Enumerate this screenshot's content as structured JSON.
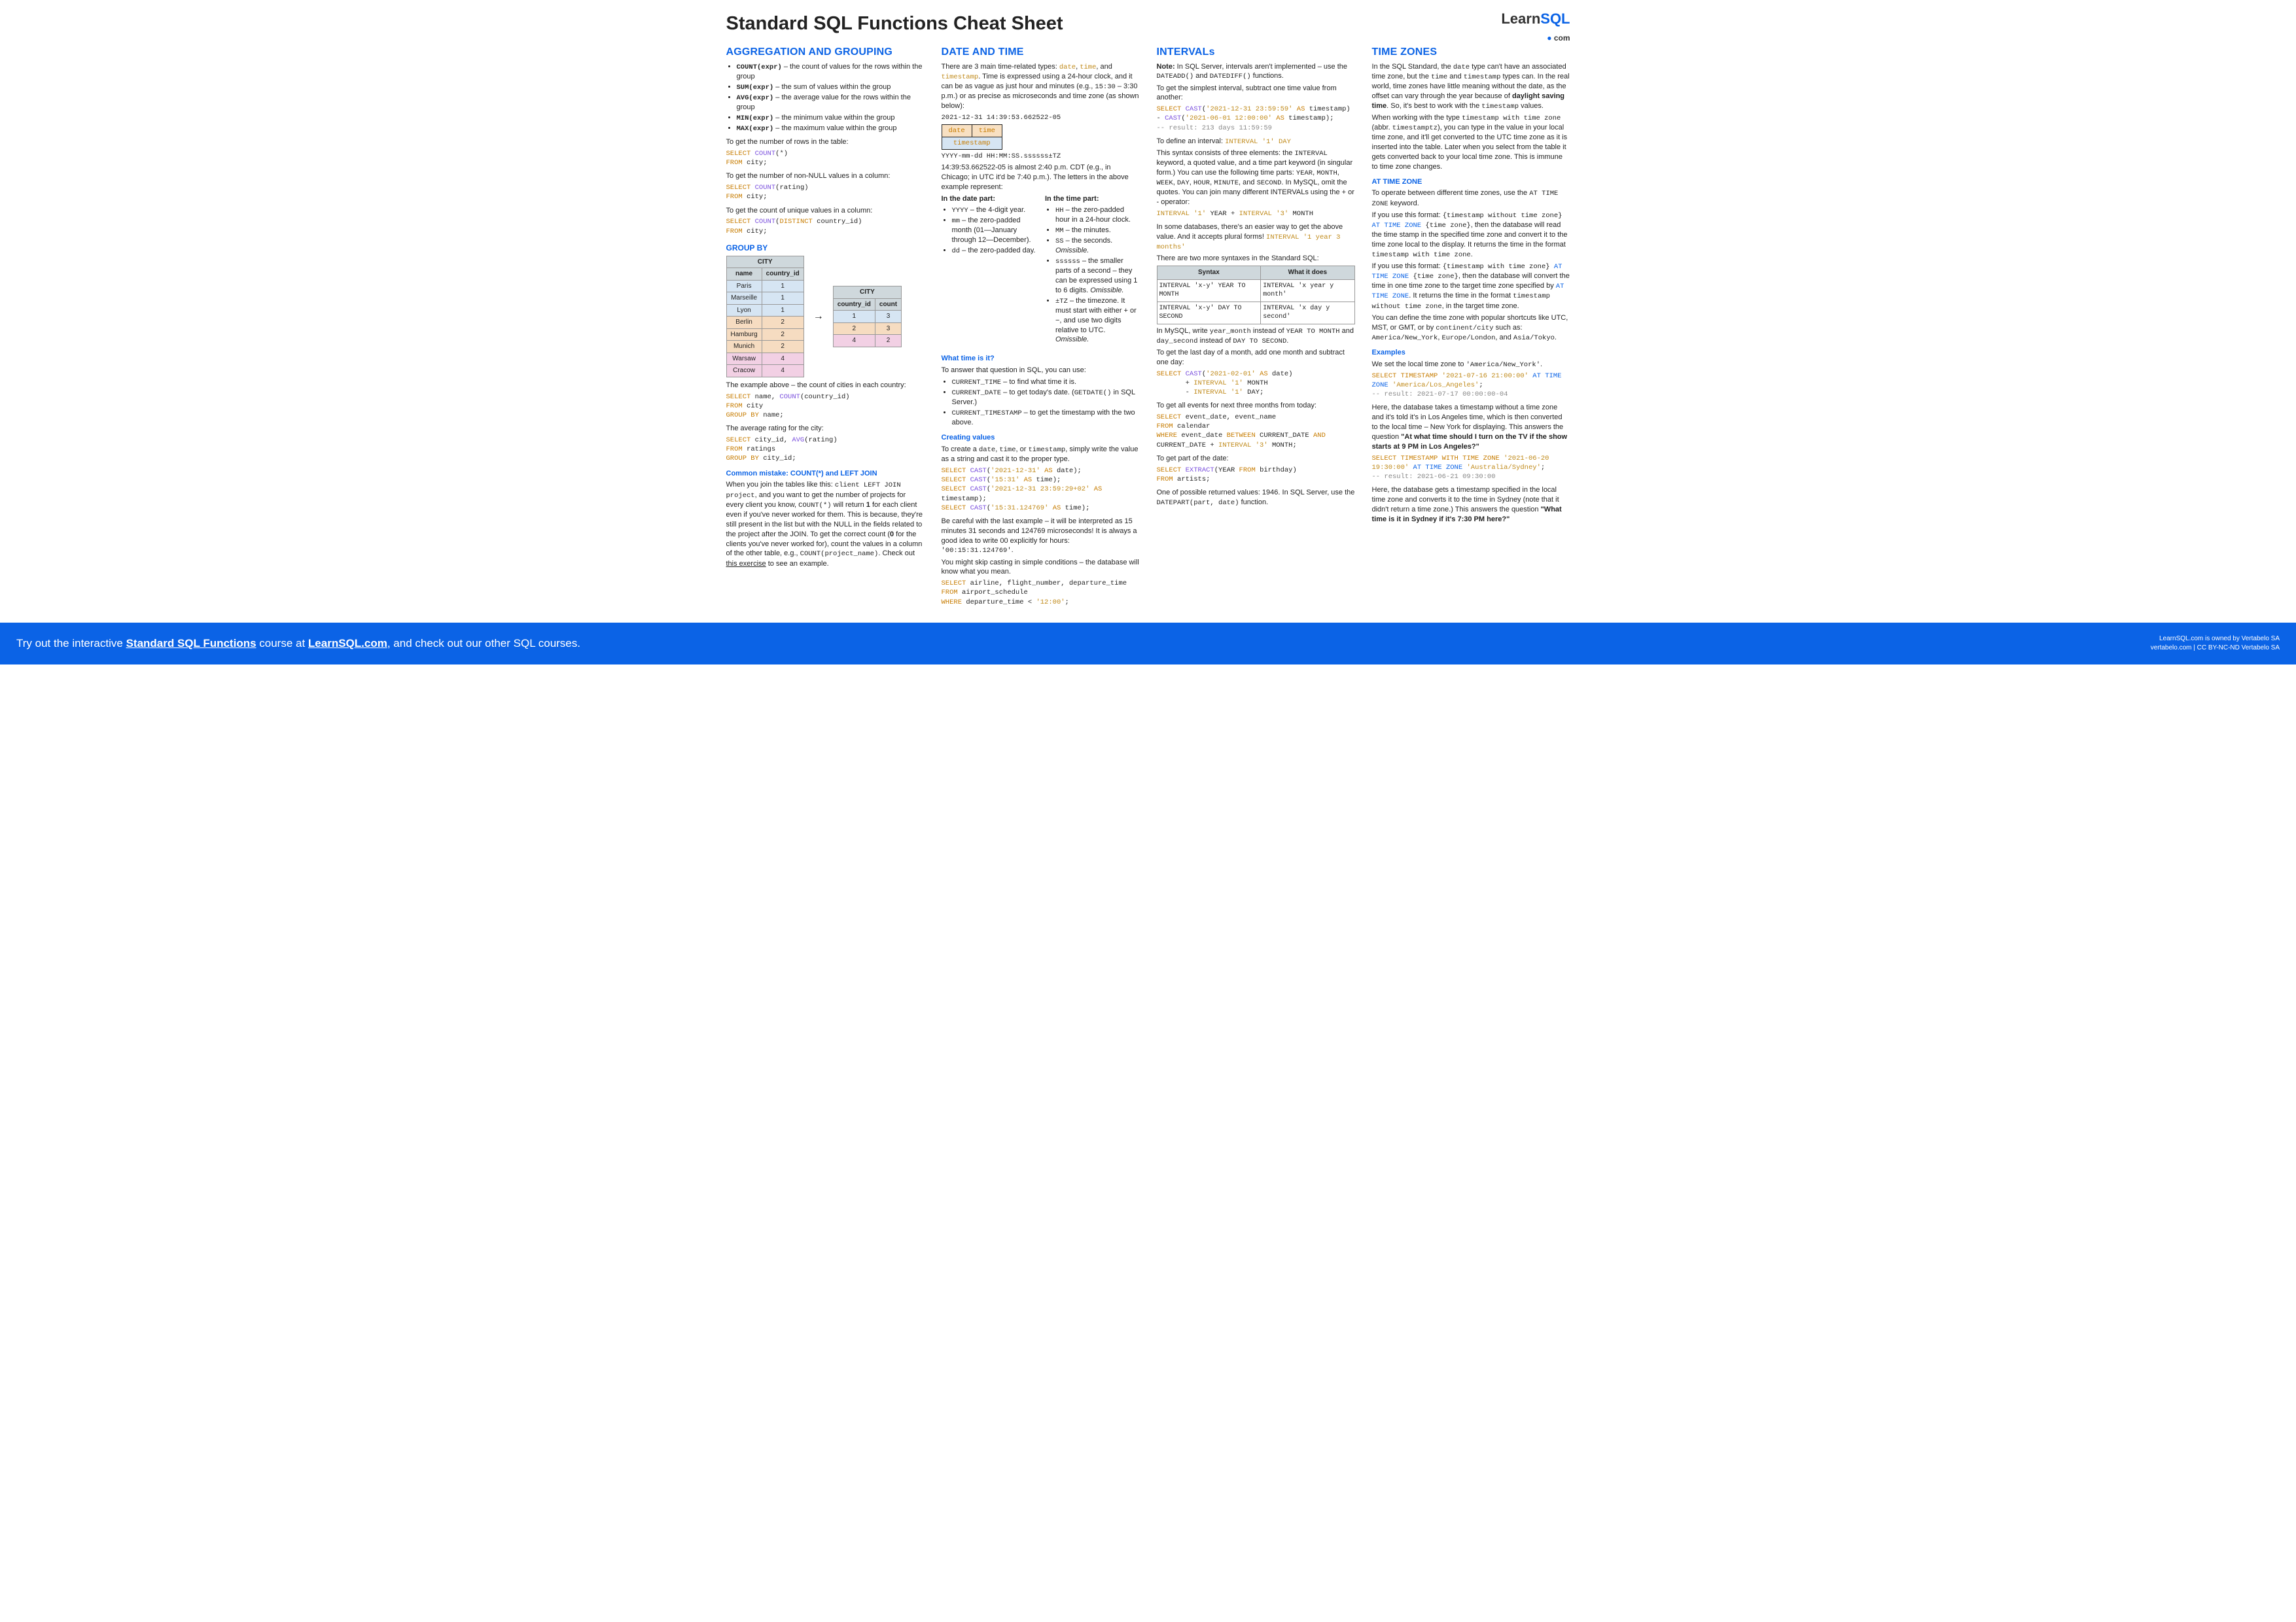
{
  "title": "Standard SQL Functions Cheat Sheet",
  "logo": {
    "brand": "Learn",
    "brand2": "SQL",
    "dot": "●",
    "com": "com"
  },
  "col1": {
    "h_agg": "AGGREGATION AND GROUPING",
    "fn_count": "COUNT(expr)",
    "fn_count_d": " – the count of values for the rows within the group",
    "fn_sum": "SUM(expr)",
    "fn_sum_d": " – the sum of values within the group",
    "fn_avg": "AVG(expr)",
    "fn_avg_d": " – the average value for the rows within the group",
    "fn_min": "MIN(expr)",
    "fn_min_d": " – the minimum value within the group",
    "fn_max": "MAX(expr)",
    "fn_max_d": " – the maximum value within the group",
    "p1": "To get the number of rows in the table:",
    "sql1": "SELECT COUNT(*)\nFROM city;",
    "p2": "To get the number of non-NULL values in a column:",
    "sql2": "SELECT COUNT(rating)\nFROM city;",
    "p3": "To get the count of unique values in a column:",
    "sql3": "SELECT COUNT(DISTINCT country_id)\nFROM city;",
    "h_group": "GROUP BY",
    "tbl1": {
      "caption": "CITY",
      "cols": [
        "name",
        "country_id"
      ],
      "rows": [
        [
          "Paris",
          "1",
          "b"
        ],
        [
          "Marseille",
          "1",
          "b"
        ],
        [
          "Lyon",
          "1",
          "b"
        ],
        [
          "Berlin",
          "2",
          "o"
        ],
        [
          "Hamburg",
          "2",
          "o"
        ],
        [
          "Munich",
          "2",
          "o"
        ],
        [
          "Warsaw",
          "4",
          "p"
        ],
        [
          "Cracow",
          "4",
          "p"
        ]
      ]
    },
    "tbl2": {
      "caption": "CITY",
      "cols": [
        "country_id",
        "count"
      ],
      "rows": [
        [
          "1",
          "3",
          "b"
        ],
        [
          "2",
          "3",
          "o"
        ],
        [
          "4",
          "2",
          "p"
        ]
      ]
    },
    "p4": "The example above – the count of cities in each country:",
    "sql4": "SELECT name, COUNT(country_id)\nFROM city\nGROUP BY name;",
    "p5": "The average rating for the city:",
    "sql5": "SELECT city_id, AVG(rating)\nFROM ratings\nGROUP BY city_id;",
    "h_mist": "Common mistake: COUNT(*) and LEFT JOIN",
    "p_mist": "When you join the tables like this: client LEFT JOIN project, and you want to get the number of projects for every client you know, COUNT(*) will return 1 for each client even if you've never worked for them. This is because, they're still present in the list but with the NULL in the fields related to the project after the JOIN. To get the correct count (0 for the clients you've never worked for), count the values in a column of the other table, e.g., COUNT(project_name). Check out this exercise to see an example."
  },
  "col2": {
    "h": "DATE AND TIME",
    "intro": "There are 3 main time-related types: date, time, and timestamp. Time is expressed using a 24-hour clock, and it can be as vague as just hour and minutes (e.g., 15:30 – 3:30 p.m.) or as precise as microseconds and time zone (as shown below):",
    "ts_raw": "2021-12-31 14:39:53.662522-05",
    "ts_date": "date",
    "ts_time": "time",
    "ts_bot": "timestamp",
    "ts_fmt": "YYYY-mm-dd HH:MM:SS.ssssss±TZ",
    "p_ts": "14:39:53.662522-05 is almost 2:40 p.m. CDT (e.g., in Chicago; in UTC it'd be 7:40 p.m.). The letters in the above example represent:",
    "h_dp": "In the date part:",
    "h_tp": "In the time part:",
    "dp": [
      "YYYY – the 4-digit year.",
      "mm – the zero-padded month (01—January through 12—December).",
      "dd – the zero-padded day."
    ],
    "tp": [
      "HH – the zero-padded hour in a 24-hour clock.",
      "MM – the minutes.",
      "SS – the seconds. Omissible.",
      "ssssss – the smaller parts of a second – they can be expressed using 1 to 6 digits. Omissible.",
      "±TZ – the timezone. It must start with either + or −, and use two digits relative to UTC. Omissible."
    ],
    "h_what": "What time is it?",
    "p_what": "To answer that question in SQL, you can use:",
    "what": [
      "CURRENT_TIME – to find what time it is.",
      "CURRENT_DATE – to get today's date. (GETDATE() in SQL Server.)",
      "CURRENT_TIMESTAMP – to get the timestamp with the two above."
    ],
    "h_create": "Creating values",
    "p_create": "To create a date, time, or timestamp, simply write the value as a string and cast it to the proper type.",
    "sql_create": "SELECT CAST('2021-12-31' AS date);\nSELECT CAST('15:31' AS time);\nSELECT CAST('2021-12-31 23:59:29+02' AS timestamp);\nSELECT CAST('15:31.124769' AS time);",
    "p_create2": "Be careful with the last example – it will be interpreted as 15 minutes 31 seconds and 124769 microseconds! It is always a good idea to write 00 explicitly for hours: '00:15:31.124769'.",
    "p_skip": "You might skip casting in simple conditions – the database will know what you mean.",
    "sql_skip": "SELECT airline, flight_number, departure_time\nFROM airport_schedule\nWHERE departure_time < '12:00';"
  },
  "col3": {
    "h": "INTERVALs",
    "note": "Note: In SQL Server, intervals aren't implemented – use the DATEADD() and DATEDIFF() functions.",
    "p1": "To get the simplest interval, subtract one time value from another:",
    "sql1": "SELECT CAST('2021-12-31 23:59:59' AS timestamp) - CAST('2021-06-01 12:00:00' AS timestamp);\n-- result: 213 days 11:59:59",
    "p2a": "To define an interval: ",
    "p2b": "INTERVAL '1' DAY",
    "p2c": "This syntax consists of three elements: the INTERVAL keyword, a quoted value, and a time part keyword (in singular form.) You can use the following time parts: YEAR, MONTH, WEEK, DAY, HOUR, MINUTE, and SECOND. In MySQL, omit the quotes. You can join many different INTERVALs using the + or - operator:",
    "sql2": "INTERVAL '1' YEAR + INTERVAL '3' MONTH",
    "p3a": "In some databases, there's an easier way to get the above value. And it accepts plural forms! ",
    "p3b": "INTERVAL '1 year 3 months'",
    "p3c": "There are two more syntaxes in the Standard SQL:",
    "tbl": {
      "cols": [
        "Syntax",
        "What it does"
      ],
      "rows": [
        [
          "INTERVAL 'x-y' YEAR TO MONTH",
          "INTERVAL 'x year y month'"
        ],
        [
          "INTERVAL 'x-y' DAY TO SECOND",
          "INTERVAL 'x day y second'"
        ]
      ]
    },
    "p4": "In MySQL, write year_month instead of YEAR TO MONTH and day_second instead of DAY TO SECOND.",
    "p5": "To get the last day of a month, add one month and subtract one day:",
    "sql5": "SELECT CAST('2021-02-01' AS date)\n       + INTERVAL '1' MONTH\n       - INTERVAL '1' DAY;",
    "p6": "To get all events for next three months from today:",
    "sql6": "SELECT event_date, event_name\nFROM calendar\nWHERE event_date BETWEEN CURRENT_DATE AND CURRENT_DATE + INTERVAL '3' MONTH;",
    "p7": "To get part of the date:",
    "sql7": "SELECT EXTRACT(YEAR FROM birthday)\nFROM artists;",
    "p8": "One of possible returned values: 1946. In SQL Server, use the DATEPART(part, date) function."
  },
  "col4": {
    "h": "TIME ZONES",
    "p1": "In the SQL Standard, the date type can't have an associated time zone, but the time and timestamp types can. In the real world, time zones have little meaning without the date, as the offset can vary through the year because of daylight saving time. So, it's best to work with the timestamp values.",
    "p2": "When working with the type timestamp with time zone (abbr. timestamptz), you can type in the value in your local time zone, and it'll get converted to the UTC time zone as it is inserted into the table. Later when you select from the table it gets converted back to your local time zone. This is immune to time zone changes.",
    "h_atz": "AT TIME ZONE",
    "p3": "To operate between different time zones, use the AT TIME ZONE keyword.",
    "p4": "If you use this format: {timestamp without time zone} AT TIME ZONE {time zone}, then the database will read the time stamp in the specified time zone and convert it to the time zone local to the display. It returns the time in the format timestamp with time zone.",
    "p5": "If you use this format: {timestamp with time zone} AT TIME ZONE {time zone}, then the database will convert the time in one time zone to the target time zone specified by AT TIME ZONE. It returns the time in the format timestamp without time zone, in the target time zone.",
    "p6": "You can define the time zone with popular shortcuts like UTC, MST, or GMT, or by continent/city such as: America/New_York, Europe/London, and Asia/Tokyo.",
    "h_ex": "Examples",
    "p7": "We set the local time zone to 'America/New_York'.",
    "sql1": "SELECT TIMESTAMP '2021-07-16 21:00:00' AT TIME ZONE 'America/Los_Angeles';\n-- result: 2021-07-17 00:00:00-04",
    "p8": "Here, the database takes a timestamp without a time zone and it's told it's in Los Angeles time, which is then converted to the local time – New York for displaying. This answers the question \"At what time should I turn on the TV if the show starts at 9 PM in Los Angeles?\"",
    "sql2": "SELECT TIMESTAMP WITH TIME ZONE '2021-06-20 19:30:00' AT TIME ZONE 'Australia/Sydney';\n-- result: 2021-06-21 09:30:00",
    "p9": "Here, the database gets a timestamp specified in the local time zone and converts it to the time in Sydney (note that it didn't return a time zone.) This answers the question \"What time is it in Sydney if it's 7:30 PM here?\""
  },
  "banner": {
    "left1": "Try out the interactive ",
    "course": "Standard SQL Functions",
    "left2": " course at ",
    "site": "LearnSQL.com",
    "left3": ", and check out our other SQL courses.",
    "r1": "LearnSQL.com is owned by Vertabelo SA",
    "r2": "vertabelo.com | CC BY-NC-ND Vertabelo SA"
  }
}
